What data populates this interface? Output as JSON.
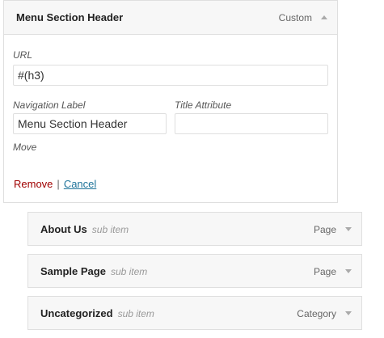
{
  "menu_item": {
    "title": "Menu Section Header",
    "type": "Custom",
    "url_label": "URL",
    "url_value": "#(h3)",
    "nav_label_label": "Navigation Label",
    "nav_label_value": "Menu Section Header",
    "title_attr_label": "Title Attribute",
    "title_attr_value": "",
    "move_label": "Move",
    "remove_label": "Remove",
    "separator": "|",
    "cancel_label": "Cancel"
  },
  "sub_items": [
    {
      "title": "About Us",
      "tag": "sub item",
      "type": "Page"
    },
    {
      "title": "Sample Page",
      "tag": "sub item",
      "type": "Page"
    },
    {
      "title": "Uncategorized",
      "tag": "sub item",
      "type": "Category"
    }
  ],
  "colors": {
    "remove_link": "#a00000",
    "cancel_link": "#21759b",
    "bar_background": "#f7f7f7",
    "border": "#dfdfdf"
  },
  "icons": {
    "expanded_toggle": "arrow-up-icon",
    "collapsed_toggle": "arrow-down-icon"
  }
}
